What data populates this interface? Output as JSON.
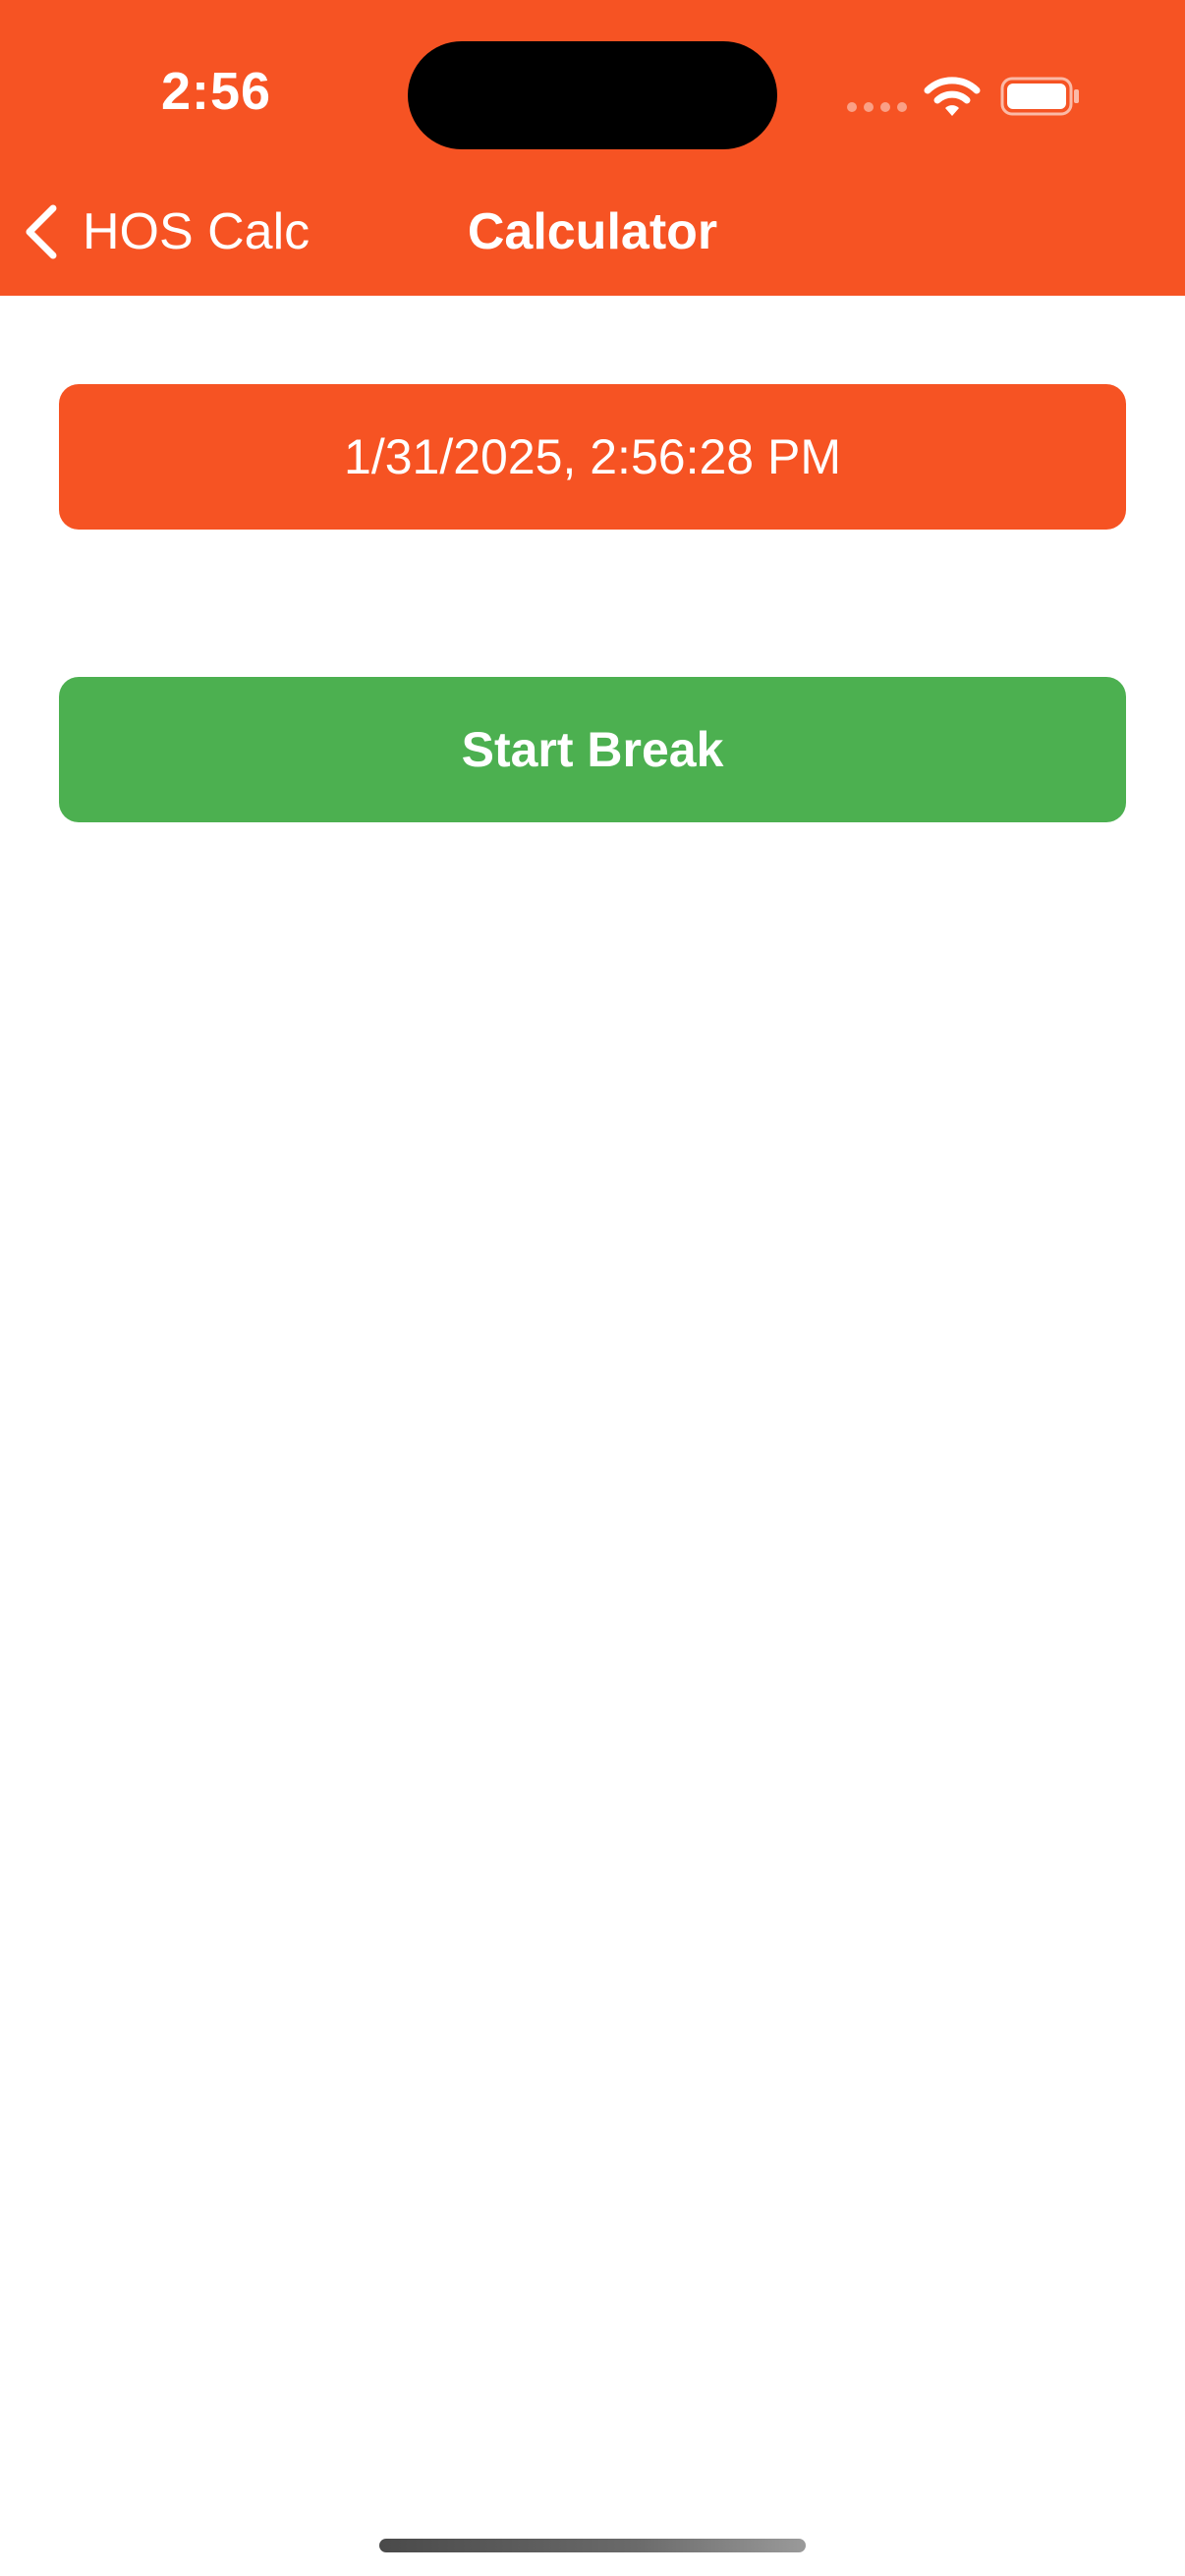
{
  "status_bar": {
    "time": "2:56",
    "icons": [
      "signal-dots-icon",
      "wifi-icon",
      "battery-icon"
    ]
  },
  "nav": {
    "back_label": "HOS Calc",
    "back_icon": "chevron-left-icon",
    "title": "Calculator"
  },
  "main": {
    "datetime_label": "1/31/2025, 2:56:28 PM",
    "start_break_label": "Start Break"
  },
  "colors": {
    "brand_orange": "#F65323",
    "start_green": "#4CB050",
    "text_on_color": "#FFFFFF",
    "background": "#FFFFFF"
  }
}
